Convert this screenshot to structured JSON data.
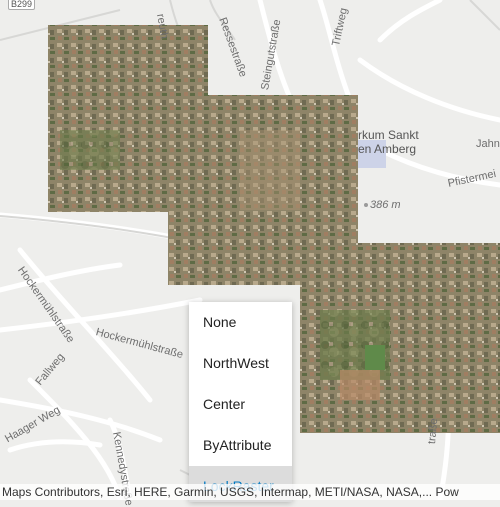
{
  "map": {
    "route_shield": "B299",
    "elevation_label": "386 m",
    "place_label_line1": "rkum Sankt",
    "place_label_line2": "en Amberg",
    "street_labels": {
      "reuth": "reuth",
      "resselstrasse": "Ressestraße",
      "steinguts": "Steingutstraße",
      "triftweg": "Triftweg",
      "hocker1": "Hockermühlstraße",
      "hocker2": "Hockermühlstraße",
      "falleweg": "Fallweg",
      "haager": "Haager Weg",
      "kennedy": "Kennedystraße",
      "jahnstr": "Jahnst",
      "pfister": "Pfistermei",
      "trasse": "traße"
    }
  },
  "menu": {
    "items": [
      {
        "label": "None"
      },
      {
        "label": "NorthWest"
      },
      {
        "label": "Center"
      },
      {
        "label": "ByAttribute"
      },
      {
        "label": "LockRaster"
      }
    ],
    "selected_index": 4
  },
  "attribution": {
    "text": "Maps Contributors, Esri, HERE, Garmin, USGS, Intermap, METI/NASA, NASA,... Pow"
  },
  "colors": {
    "accent": "#0079c1",
    "selected_bg": "#dcdcdc",
    "basemap": "#eeeeec"
  }
}
